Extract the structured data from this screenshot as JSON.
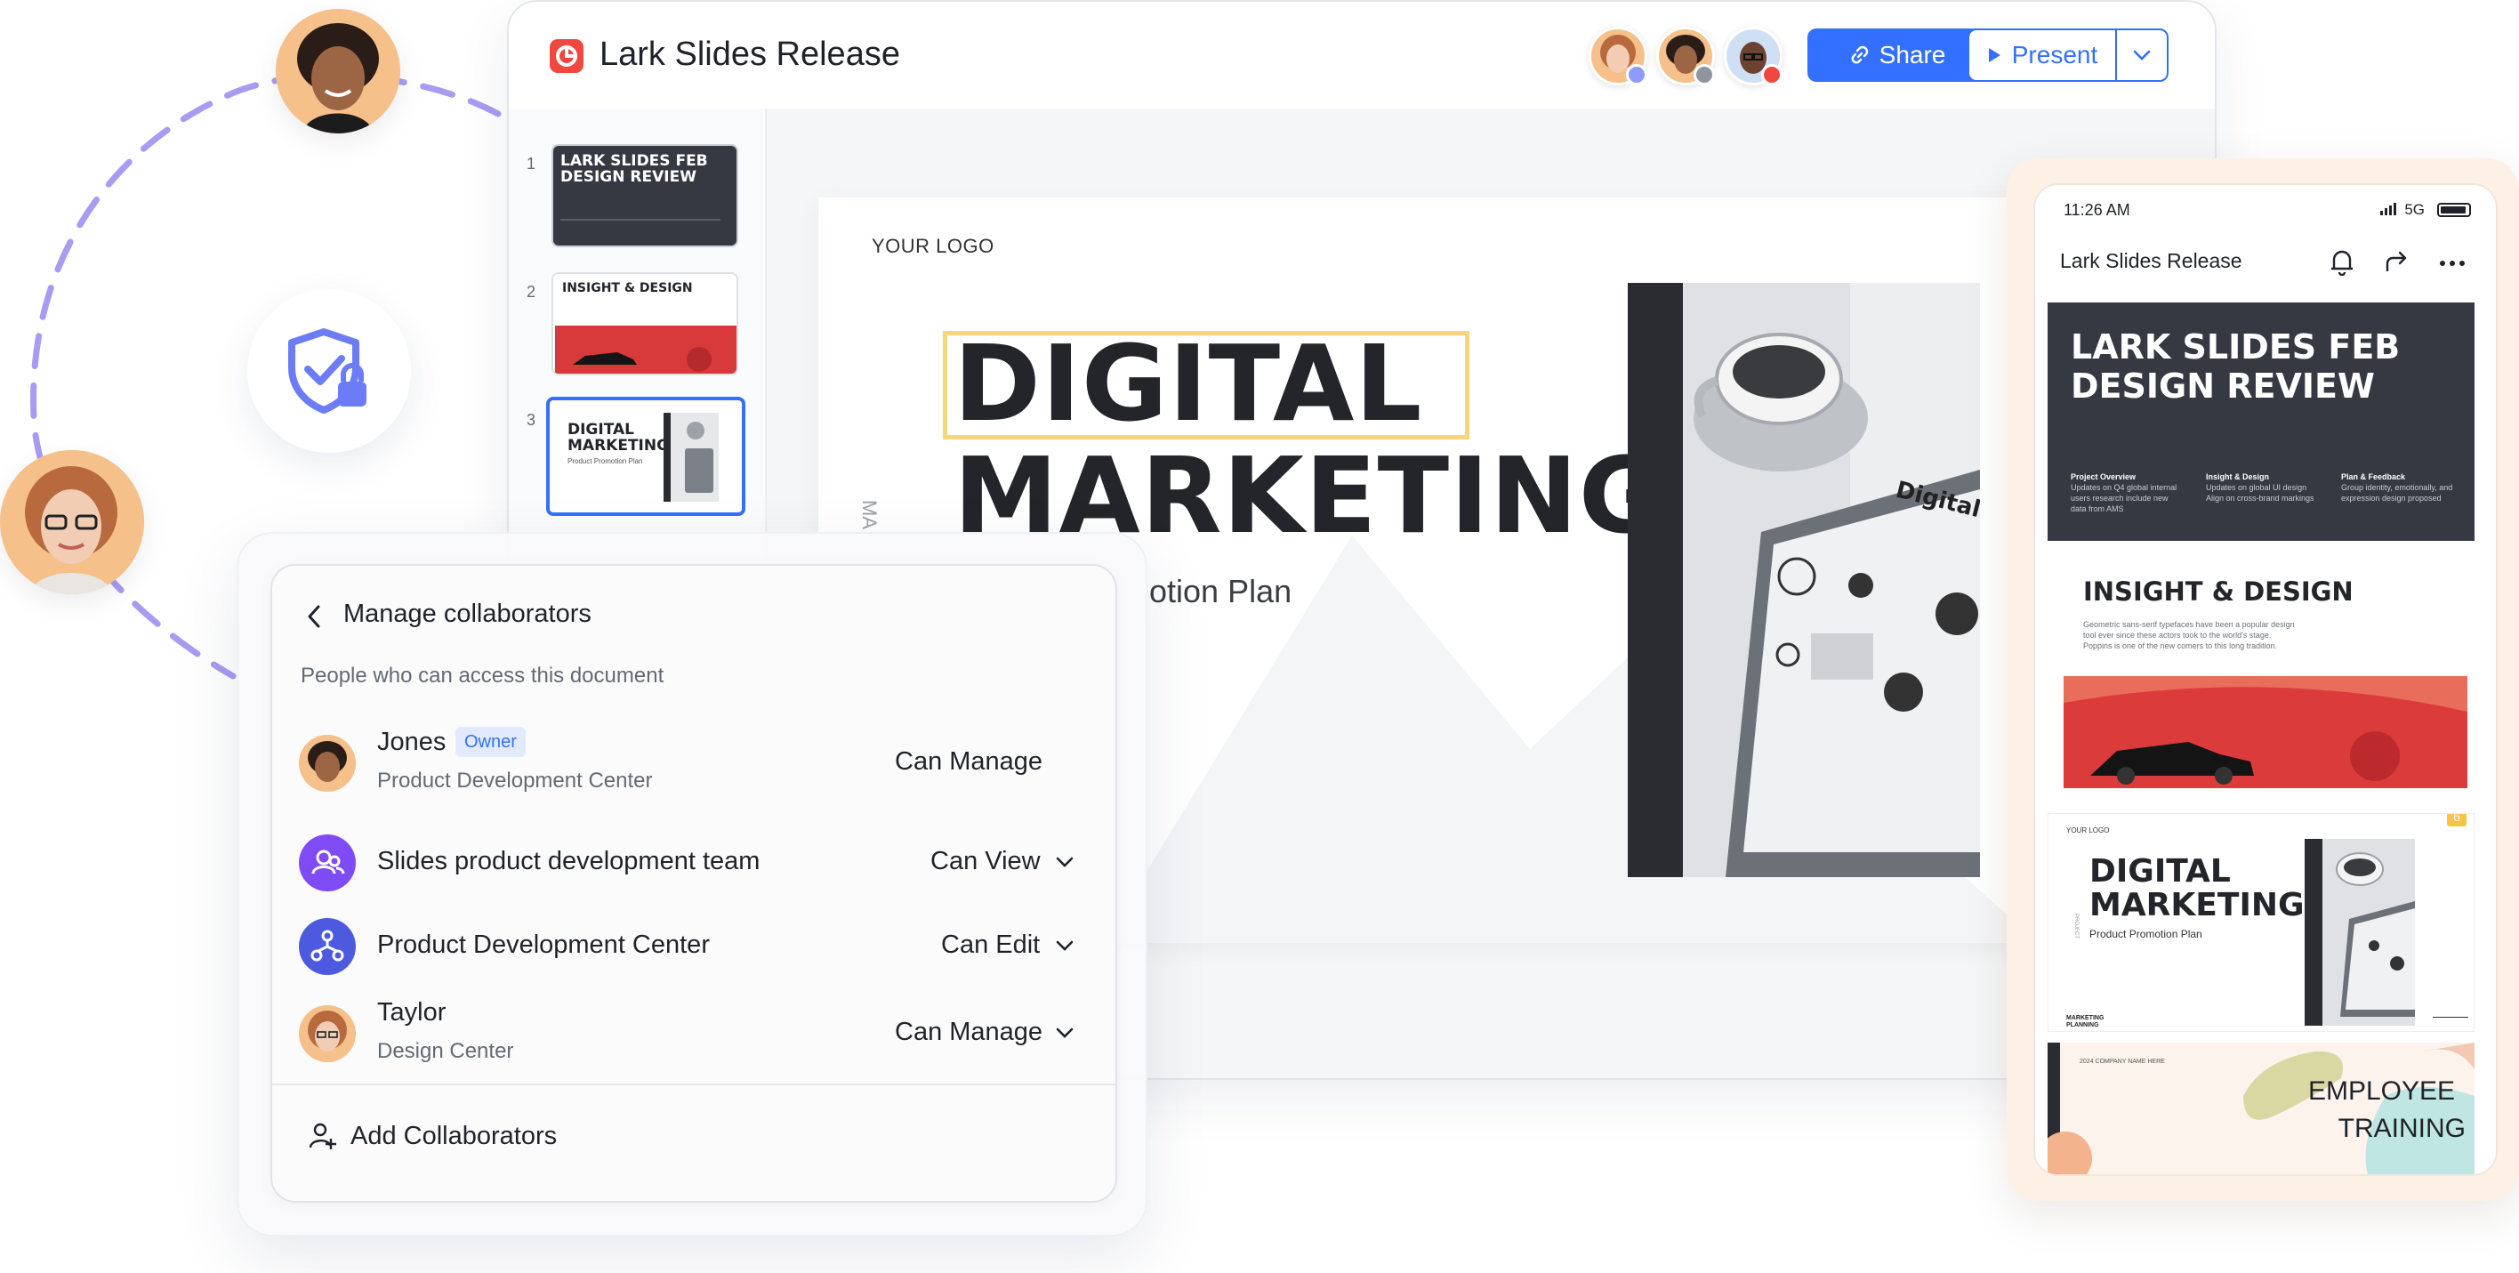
{
  "window": {
    "title": "Lark Slides Release",
    "share_label": "Share",
    "present_label": "Present"
  },
  "thumbnails": [
    {
      "num": "1",
      "title": "LARK SLIDES FEB DESIGN REVIEW"
    },
    {
      "num": "2",
      "title": "INSIGHT & DESIGN"
    },
    {
      "num": "3",
      "title": "DIGITAL MARKETING",
      "subtitle": "Product Promotion Plan"
    }
  ],
  "slide": {
    "logo": "YOUR LOGO",
    "headline_line1": "DIGITAL",
    "headline_line2": "MARKETING",
    "subtitle": "otion Plan",
    "vertical": "MA"
  },
  "collaborators_panel": {
    "title": "Manage collaborators",
    "description": "People who can access this document",
    "owner_badge": "Owner",
    "rows": [
      {
        "name": "Jones",
        "sub": "Product Development Center",
        "permission": "Can Manage"
      },
      {
        "name": "Slides product development team",
        "sub": "",
        "permission": "Can View"
      },
      {
        "name": "Product Development Center",
        "sub": "",
        "permission": "Can Edit"
      },
      {
        "name": "Taylor",
        "sub": "Design Center",
        "permission": "Can Manage"
      }
    ],
    "add_label": "Add Collaborators"
  },
  "phone": {
    "time": "11:26 AM",
    "network": "5G",
    "title": "Lark Slides Release",
    "card1_title": "LARK SLIDES FEB DESIGN REVIEW",
    "card1_cols": [
      {
        "head": "Project Overview",
        "body": "Updates on Q4 global internal users research include new data from AMS"
      },
      {
        "head": "Insight & Design",
        "body": "Updates on global UI design Align on cross-brand markings"
      },
      {
        "head": "Plan & Feedback",
        "body": "Group identity, emotionally, and expression design proposed"
      }
    ],
    "card2_title": "INSIGHT & DESIGN",
    "card2_body": "Geometric sans-serif typefaces have been a popular design tool ever since these actors took to the world's stage. Poppins is one of the new comers to this long tradition.",
    "card3_logo": "YOUR LOGO",
    "card3_title": "DIGITAL MARKETING",
    "card3_sub": "Product Promotion Plan",
    "card3_vertical": "PROJECT",
    "card3_footer": "MARKETING PLANNING",
    "card3_badge": "6",
    "card4_company": "2024 COMPANY NAME HERE",
    "card4_line1": "EMPLOYEE",
    "card4_line2": "TRAINING"
  },
  "colors": {
    "accent": "#3370ff",
    "app_icon": "#f0483e",
    "dark_slide": "#373942",
    "highlight": "#f5d77a",
    "arc": "#a99bf2"
  }
}
